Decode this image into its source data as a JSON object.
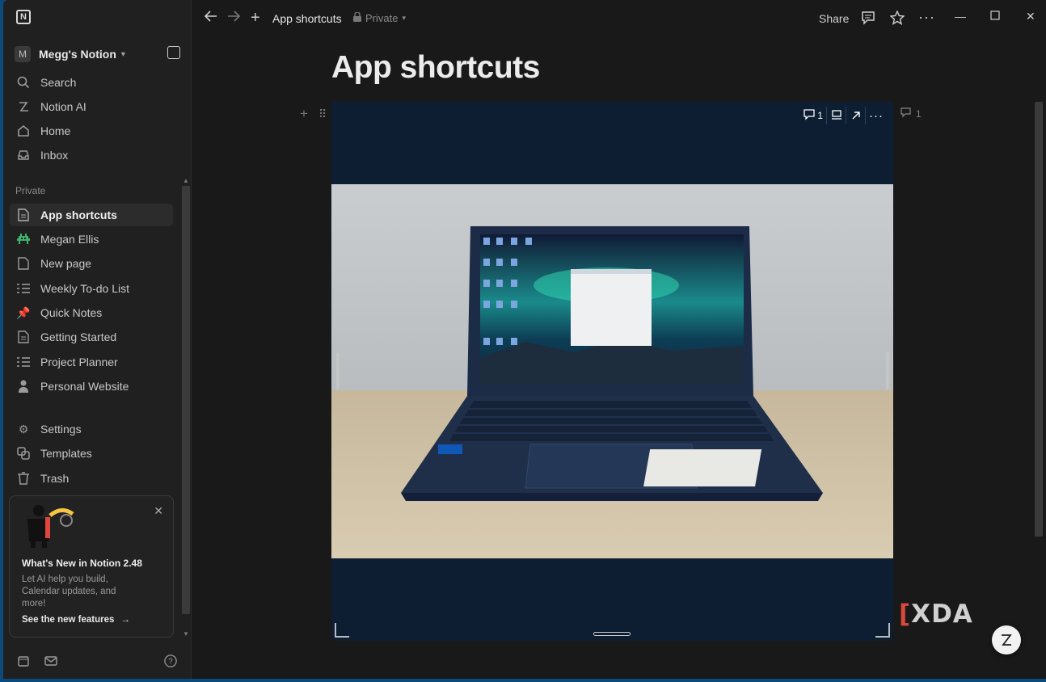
{
  "workspace": {
    "avatar": "M",
    "name": "Megg's Notion"
  },
  "nav": [
    {
      "label": "Search",
      "icon": "search-icon"
    },
    {
      "label": "Notion AI",
      "icon": "notion-ai-icon"
    },
    {
      "label": "Home",
      "icon": "home-icon"
    },
    {
      "label": "Inbox",
      "icon": "inbox-icon"
    }
  ],
  "private_label": "Private",
  "pages": [
    {
      "label": "App shortcuts",
      "icon": "page-icon",
      "active": true
    },
    {
      "label": "Megan Ellis",
      "icon": "space-invader-icon"
    },
    {
      "label": "New page",
      "icon": "page-icon"
    },
    {
      "label": "Weekly To-do List",
      "icon": "checklist-icon"
    },
    {
      "label": "Quick Notes",
      "icon": "pushpin-icon"
    },
    {
      "label": "Getting Started",
      "icon": "page-icon"
    },
    {
      "label": "Project Planner",
      "icon": "checklist-icon"
    },
    {
      "label": "Personal Website",
      "icon": "person-icon"
    }
  ],
  "utility": [
    {
      "label": "Settings",
      "icon": "gear-icon"
    },
    {
      "label": "Templates",
      "icon": "templates-icon"
    },
    {
      "label": "Trash",
      "icon": "trash-icon"
    }
  ],
  "promo": {
    "title": "What's New in Notion 2.48",
    "body": "Let AI help you build, Calendar updates, and more!",
    "link": "See the new features"
  },
  "topbar": {
    "add": "+",
    "title": "App shortcuts",
    "privacy": "Private",
    "share": "Share"
  },
  "page": {
    "title": "App shortcuts"
  },
  "image_toolbar": {
    "comment_count": "1"
  },
  "side_comment_count": "1",
  "watermark": {
    "left": "[",
    "brand": "XDA"
  }
}
